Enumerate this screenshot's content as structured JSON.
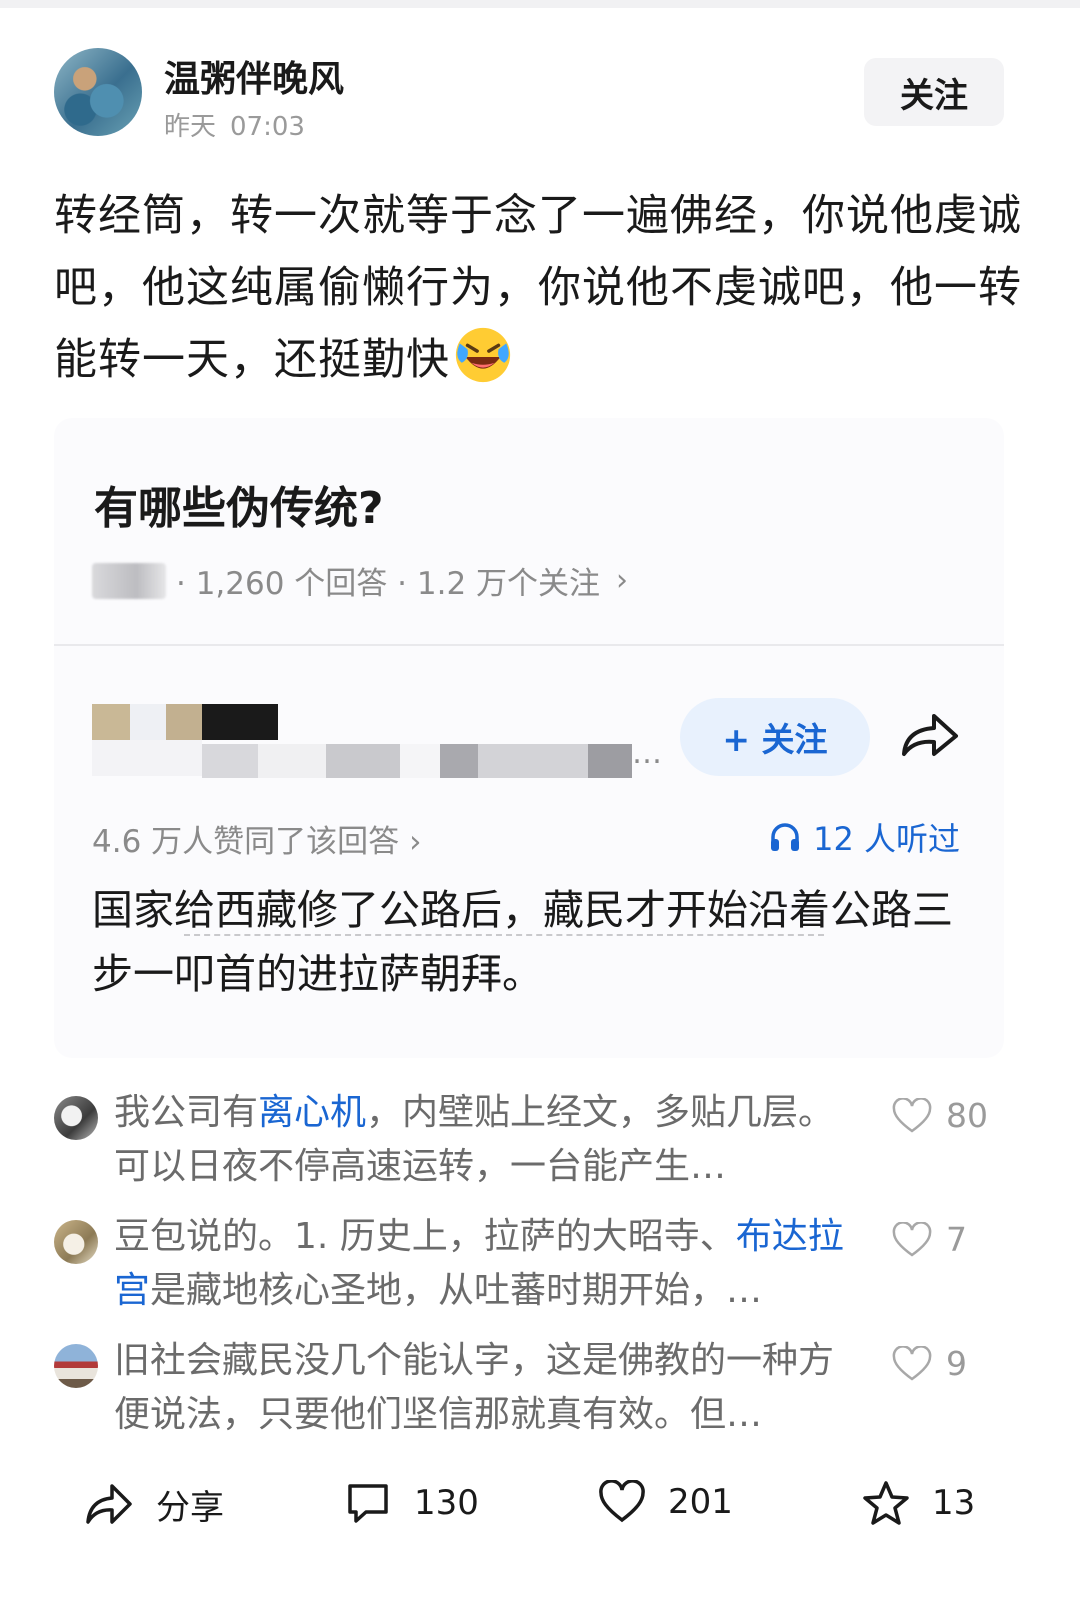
{
  "post": {
    "author": "温粥伴晚风",
    "time_day": "昨天",
    "time_clock": "07:03",
    "follow_label": "关注",
    "body_text": "转经筒，转一次就等于念了一遍佛经，你说他虔诚吧，他这纯属偷懒行为，你说他不虔诚吧，他一转能转一天，还挺勤快",
    "body_emoji": "laughing-crying-emoji"
  },
  "quote": {
    "question_title": "有哪些伪传统?",
    "answers_count": "· 1,260 个回答 · 1.2 万个关注",
    "chevron": "›",
    "follow_label": "+ 关注",
    "ellipsis": "…",
    "agree_text": "4.6 万人赞同了该回答",
    "listen_text": "12 人听过",
    "answer_text": "国家给西藏修了公路后，藏民才开始沿着公路三步一叩首的进拉萨朝拜。"
  },
  "comments": [
    {
      "text_before": "我公司有",
      "link": "离心机",
      "text_after": "，内壁贴上经文，多贴几层。可以日夜不停高速运转，一台能产生…",
      "likes": "80"
    },
    {
      "text_before": "豆包说的。1. 历史上，拉萨的大昭寺、",
      "link": "布达拉宫",
      "text_after": "是藏地核心圣地，从吐蕃时期开始，…",
      "likes": "7"
    },
    {
      "text_before": "旧社会藏民没几个能认字，这是佛教的一种方便说法，只要他们坚信那就真有效。但…",
      "link": "",
      "text_after": "",
      "likes": "9"
    }
  ],
  "bottom_bar": {
    "share_label": "分享",
    "comments_count": "130",
    "likes_count": "201",
    "favorites_count": "13"
  },
  "colors": {
    "link_blue": "#1a66d2",
    "follow_bg": "#e8f1fd",
    "muted_text": "#8a8a8a"
  }
}
